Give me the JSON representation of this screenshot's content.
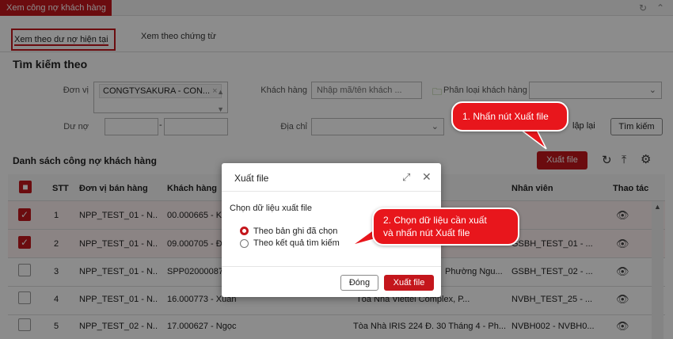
{
  "top": {
    "title": "Xem công nợ khách hàng"
  },
  "tabs": {
    "current": "Xem theo dư nợ hiện tại",
    "documents": "Xem theo chứng từ"
  },
  "search": {
    "heading": "Tìm kiếm theo",
    "don_vi_label": "Đơn vị",
    "don_vi_value": "CONGTYSAKURA - CON...",
    "khach_hang_label": "Khách hàng",
    "khach_hang_placeholder": "Nhập mã/tên khách ...",
    "phan_loai_label": "Phân loại khách hàng",
    "du_no_label": "Dư nợ",
    "dia_chi_label": "Địa chỉ",
    "reset_label": "lập lại",
    "search_button": "Tìm kiếm"
  },
  "list": {
    "heading": "Danh sách công nợ khách hàng",
    "export_button": "Xuất file",
    "columns": {
      "stt": "STT",
      "don_vi": "Đơn vị bán hàng",
      "khach_hang": "Khách hàng",
      "nhan_vien": "Nhân viên",
      "thao_tac": "Thao tác"
    },
    "rows": [
      {
        "stt": "1",
        "don_vi": "NPP_TEST_01 - N...",
        "khach_hang": "00.000665 - Kh",
        "dia_chi": "",
        "nhan_vien": "",
        "checked": true
      },
      {
        "stt": "2",
        "don_vi": "NPP_TEST_01 - N...",
        "khach_hang": "09.000705 - Đặ",
        "dia_chi": "",
        "nhan_vien": "GSBH_TEST_01 - ...",
        "checked": true
      },
      {
        "stt": "3",
        "don_vi": "NPP_TEST_01 - N...",
        "khach_hang": "SPP02000087",
        "dia_chi": "Phường Ngu...",
        "nhan_vien": "GSBH_TEST_02 - ...",
        "checked": false
      },
      {
        "stt": "4",
        "don_vi": "NPP_TEST_01 - N...",
        "khach_hang": "16.000773 - Xuân",
        "dia_chi": "Tòa Nhà Viettel Complex, P...",
        "nhan_vien": "NVBH_TEST_25 - ...",
        "checked": false
      },
      {
        "stt": "5",
        "don_vi": "NPP_TEST_02 - N...",
        "khach_hang": "17.000627 - Ngọc",
        "dia_chi": "Tòa Nhà IRIS 224 Đ. 30 Tháng 4 - Ph...",
        "nhan_vien": "NVBH002 - NVBH0...",
        "checked": false
      }
    ]
  },
  "modal": {
    "title": "Xuất file",
    "prompt": "Chọn dữ liệu xuất file",
    "option_selected": "Theo bản ghi đã chọn",
    "option_search": "Theo kết quả tìm kiếm",
    "close_button": "Đóng",
    "export_button": "Xuất file"
  },
  "callouts": {
    "step1": "1. Nhấn nút Xuất file",
    "step2_line1": "2. Chọn dữ liệu cần xuất",
    "step2_line2": "và nhấn nút Xuất file"
  },
  "colors": {
    "accent": "#c4161c",
    "callout": "#e8161c"
  }
}
